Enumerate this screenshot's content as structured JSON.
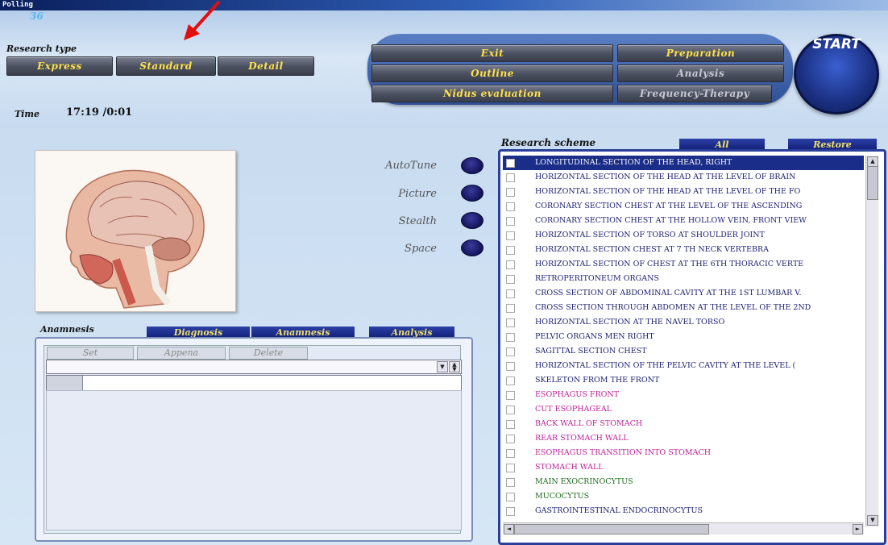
{
  "window": {
    "title": "Polling"
  },
  "counter": "36",
  "research_type": {
    "label": "Research type",
    "buttons": [
      "Express",
      "Standard",
      "Detail"
    ]
  },
  "time": {
    "label": "Time",
    "value": "17:19 /0:01"
  },
  "top_buttons": {
    "exit": "Exit",
    "outline": "Outline",
    "nidus": "Nidus evaluation",
    "preparation": "Preparation",
    "analysis": "Analysis",
    "frequency": "Frequency-Therapy",
    "start": "START"
  },
  "toggles": [
    {
      "label": "AutoTune"
    },
    {
      "label": "Picture"
    },
    {
      "label": "Stealth"
    },
    {
      "label": "Space"
    }
  ],
  "anamnesis": {
    "heading": "Anamnesis",
    "tabs": [
      "Diagnosis",
      "Anamnesis",
      "Analysis"
    ],
    "buttons": {
      "set": "Set",
      "append": "Appena",
      "delete": "Delete"
    }
  },
  "research_scheme": {
    "heading": "Research scheme",
    "tabs": {
      "all": "All",
      "restore": "Restore"
    },
    "items": [
      {
        "text": "LONGITUDINAL SECTION OF THE HEAD, RIGHT",
        "color": "#1a2d88",
        "selected": true
      },
      {
        "text": "HORIZONTAL SECTION OF THE HEAD AT THE LEVEL OF BRAIN",
        "color": "#1a1f6e"
      },
      {
        "text": "HORIZONTAL SECTION OF THE HEAD AT THE LEVEL OF THE FO",
        "color": "#1a1f6e"
      },
      {
        "text": "CORONARY SECTION CHEST AT THE LEVEL OF THE ASCENDING",
        "color": "#1a1f6e"
      },
      {
        "text": "CORONARY SECTION CHEST AT THE HOLLOW VEIN, FRONT VIEW",
        "color": "#1a1f6e"
      },
      {
        "text": "HORIZONTAL SECTION OF TORSO AT SHOULDER JOINT",
        "color": "#1a1f6e"
      },
      {
        "text": "HORIZONTAL SECTION CHEST AT 7 TH NECK VERTEBRA",
        "color": "#1a1f6e"
      },
      {
        "text": "HORIZONTAL SECTION OF CHEST AT THE 6TH THORACIC VERTE",
        "color": "#1a1f6e"
      },
      {
        "text": "RETROPERITONEUM ORGANS",
        "color": "#1a1f6e"
      },
      {
        "text": "CROSS SECTION OF ABDOMINAL CAVITY AT THE 1ST LUMBAR V.",
        "color": "#1a1f6e"
      },
      {
        "text": "CROSS SECTION THROUGH ABDOMEN AT THE LEVEL OF THE 2ND",
        "color": "#1a1f6e"
      },
      {
        "text": "HORIZONTAL SECTION AT THE NAVEL TORSO",
        "color": "#1a1f6e"
      },
      {
        "text": "PELVIC ORGANS MEN RIGHT",
        "color": "#1a1f6e"
      },
      {
        "text": "SAGITTAL SECTION CHEST",
        "color": "#1a1f6e"
      },
      {
        "text": "HORIZONTAL SECTION OF THE PELVIC CAVITY AT THE LEVEL (",
        "color": "#1a1f6e"
      },
      {
        "text": "SKELETON FROM THE FRONT",
        "color": "#1a1f6e"
      },
      {
        "text": "ESOPHAGUS FRONT",
        "color": "#c0209a"
      },
      {
        "text": "CUT ESOPHAGEAL",
        "color": "#c0209a"
      },
      {
        "text": "BACK WALL OF STOMACH",
        "color": "#c0209a"
      },
      {
        "text": "REAR STOMACH WALL",
        "color": "#c0209a"
      },
      {
        "text": "ESOPHAGUS TRANSITION INTO STOMACH",
        "color": "#c0209a"
      },
      {
        "text": "STOMACH WALL",
        "color": "#c0209a"
      },
      {
        "text": "MAIN EXOCRINOCYTUS",
        "color": "#1e6b1e"
      },
      {
        "text": "MUCOCYTUS",
        "color": "#1e6b1e"
      },
      {
        "text": "GASTROINTESTINAL ENDOCRINOCYTUS",
        "color": "#1a1f6e"
      }
    ]
  },
  "colors": {
    "accent_yellow": "#ffe24a",
    "tab_blue": "#0f1c72",
    "arrow_red": "#e01010"
  }
}
